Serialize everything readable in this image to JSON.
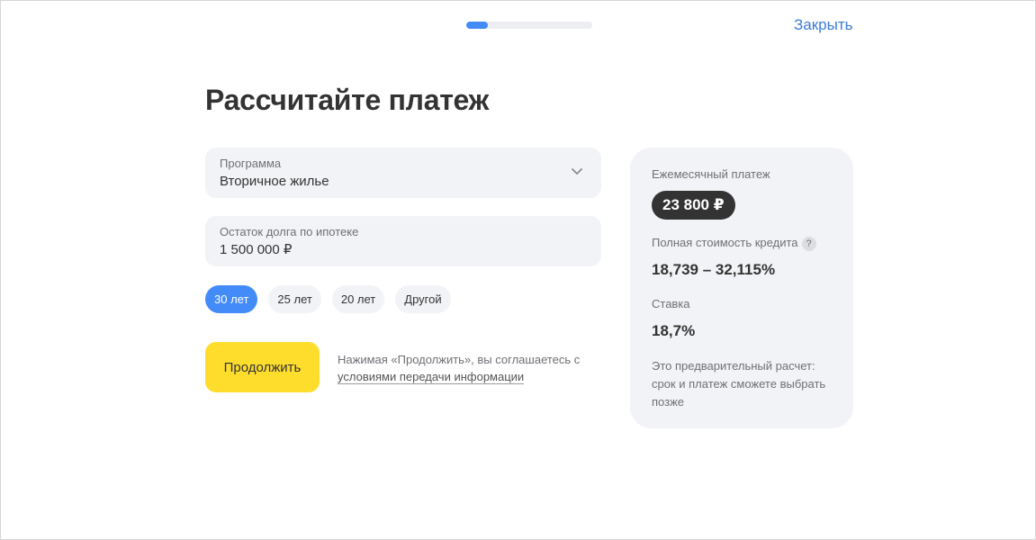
{
  "progress": {
    "value": 0.17
  },
  "header": {
    "close_label": "Закрыть"
  },
  "page": {
    "title": "Рассчитайте платеж"
  },
  "form": {
    "program": {
      "label": "Программа",
      "value": "Вторичное жилье"
    },
    "debt": {
      "label": "Остаток долга по ипотеке",
      "value": "1 500 000 ₽"
    },
    "terms": [
      {
        "label": "30 лет",
        "selected": true
      },
      {
        "label": "25 лет",
        "selected": false
      },
      {
        "label": "20 лет",
        "selected": false
      },
      {
        "label": "Другой",
        "selected": false
      }
    ],
    "continue_label": "Продолжить",
    "consent_text": "Нажимая «Продолжить», вы соглашаетесь с",
    "consent_link": "условиями передачи информации"
  },
  "summary": {
    "monthly_label": "Ежемесячный платеж",
    "monthly_value": "23 800 ₽",
    "full_cost_label": "Полная стоимость кредита",
    "full_cost_help": "?",
    "full_cost_value": "18,739 – 32,115%",
    "rate_label": "Ставка",
    "rate_value": "18,7%",
    "note": "Это предварительный расчет: срок и платеж сможете выбрать позже"
  },
  "colors": {
    "accent": "#428bf9",
    "primary_button": "#ffdd2d",
    "link": "#3a7bd5",
    "panel": "#f2f3f6"
  },
  "icons": {
    "program_dropdown": "chevron-down-icon",
    "full_cost_help": "help-icon"
  }
}
